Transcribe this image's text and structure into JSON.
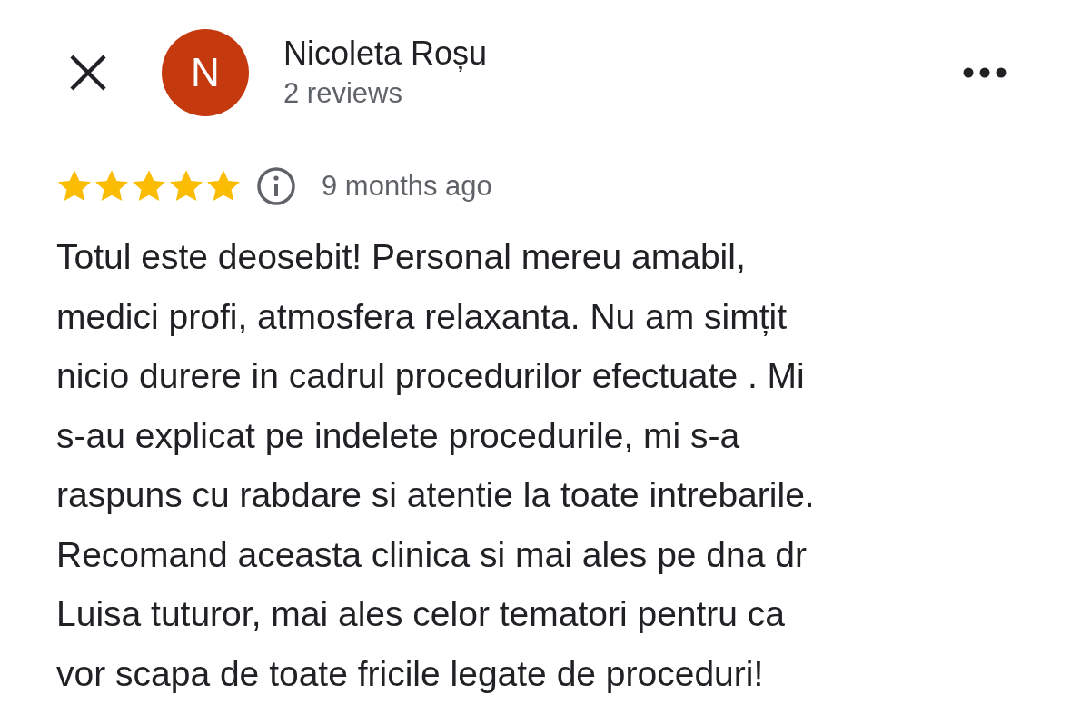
{
  "reviewer": {
    "initial": "N",
    "name": "Nicoleta Roșu",
    "reviews": "2 reviews"
  },
  "rating": {
    "stars": 5,
    "time": "9 months ago"
  },
  "review_text": "Totul este deosebit! Personal mereu amabil,\nmedici profi, atmosfera relaxanta. Nu am simțit\nnicio durere in cadrul procedurilor efectuate . Mi\ns-au explicat pe indelete procedurile, mi s-a\nraspuns cu rabdare si atentie la toate intrebarile.\nRecomand aceasta clinica si mai ales pe dna dr\nLuisa tuturor, mai ales celor tematori pentru ca\nvor scapa de toate fricile legate de proceduri!"
}
